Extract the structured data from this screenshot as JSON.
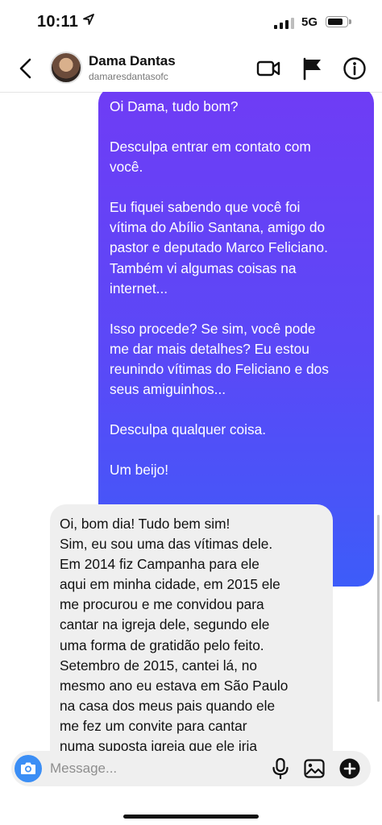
{
  "status_bar": {
    "time": "10:11",
    "network": "5G",
    "battery_level": 0.85
  },
  "header": {
    "name": "Dama Dantas",
    "username": "damaresdantasofc",
    "icons": [
      "back-icon",
      "video-call-icon",
      "flag-icon",
      "info-icon"
    ]
  },
  "messages": {
    "outgoing": {
      "paragraphs": [
        [
          "Oi Dama, tudo bom?"
        ],
        [
          "Desculpa entrar em contato com",
          "você."
        ],
        [
          "Eu fiquei sabendo que você foi",
          "vítima do Abílio Santana, amigo do",
          "pastor e deputado Marco Feliciano.",
          "Também vi algumas coisas na",
          "internet..."
        ],
        [
          "Isso procede? Se sim, você pode",
          "me dar mais detalhes? Eu estou",
          "reunindo vítimas do Feliciano e dos",
          "seus amiguinhos..."
        ],
        [
          "Desculpa qualquer coisa."
        ],
        [
          "Um beijo!"
        ]
      ]
    },
    "incoming": {
      "lines": [
        "Oi, bom dia! Tudo bem sim!",
        "Sim, eu sou uma das vítimas dele.",
        "Em 2014 fiz Campanha para ele",
        "aqui em minha cidade, em 2015 ele",
        "me procurou e me convidou para",
        "cantar na igreja dele, segundo ele",
        "uma forma de gratidão pelo feito.",
        "Setembro de 2015, cantei lá, no",
        "mesmo ano eu estava em São Paulo",
        "na casa dos meus pais quando ele",
        "me fez um convite para cantar",
        "numa suposta igreja que ele iria"
      ]
    }
  },
  "composer": {
    "placeholder": "Message...",
    "icons": [
      "camera-icon",
      "microphone-icon",
      "image-icon",
      "add-icon"
    ]
  },
  "colors": {
    "accent_start": "#6f3cf5",
    "accent_end": "#3d5cf9",
    "camera_button": "#3b8ef5"
  }
}
